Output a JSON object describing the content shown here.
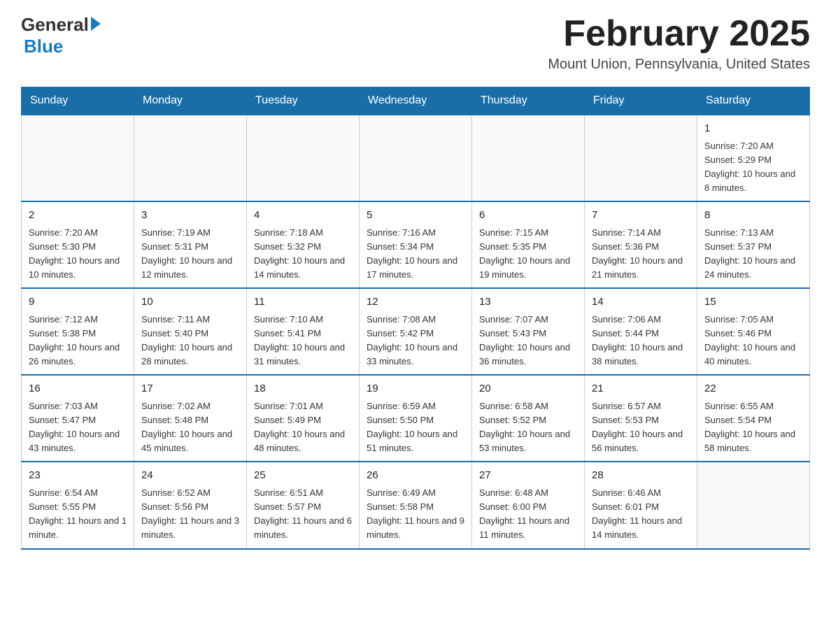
{
  "header": {
    "logo_general": "General",
    "logo_blue": "Blue",
    "month_title": "February 2025",
    "location": "Mount Union, Pennsylvania, United States"
  },
  "weekdays": [
    "Sunday",
    "Monday",
    "Tuesday",
    "Wednesday",
    "Thursday",
    "Friday",
    "Saturday"
  ],
  "weeks": [
    [
      {
        "day": "",
        "info": ""
      },
      {
        "day": "",
        "info": ""
      },
      {
        "day": "",
        "info": ""
      },
      {
        "day": "",
        "info": ""
      },
      {
        "day": "",
        "info": ""
      },
      {
        "day": "",
        "info": ""
      },
      {
        "day": "1",
        "info": "Sunrise: 7:20 AM\nSunset: 5:29 PM\nDaylight: 10 hours and 8 minutes."
      }
    ],
    [
      {
        "day": "2",
        "info": "Sunrise: 7:20 AM\nSunset: 5:30 PM\nDaylight: 10 hours and 10 minutes."
      },
      {
        "day": "3",
        "info": "Sunrise: 7:19 AM\nSunset: 5:31 PM\nDaylight: 10 hours and 12 minutes."
      },
      {
        "day": "4",
        "info": "Sunrise: 7:18 AM\nSunset: 5:32 PM\nDaylight: 10 hours and 14 minutes."
      },
      {
        "day": "5",
        "info": "Sunrise: 7:16 AM\nSunset: 5:34 PM\nDaylight: 10 hours and 17 minutes."
      },
      {
        "day": "6",
        "info": "Sunrise: 7:15 AM\nSunset: 5:35 PM\nDaylight: 10 hours and 19 minutes."
      },
      {
        "day": "7",
        "info": "Sunrise: 7:14 AM\nSunset: 5:36 PM\nDaylight: 10 hours and 21 minutes."
      },
      {
        "day": "8",
        "info": "Sunrise: 7:13 AM\nSunset: 5:37 PM\nDaylight: 10 hours and 24 minutes."
      }
    ],
    [
      {
        "day": "9",
        "info": "Sunrise: 7:12 AM\nSunset: 5:38 PM\nDaylight: 10 hours and 26 minutes."
      },
      {
        "day": "10",
        "info": "Sunrise: 7:11 AM\nSunset: 5:40 PM\nDaylight: 10 hours and 28 minutes."
      },
      {
        "day": "11",
        "info": "Sunrise: 7:10 AM\nSunset: 5:41 PM\nDaylight: 10 hours and 31 minutes."
      },
      {
        "day": "12",
        "info": "Sunrise: 7:08 AM\nSunset: 5:42 PM\nDaylight: 10 hours and 33 minutes."
      },
      {
        "day": "13",
        "info": "Sunrise: 7:07 AM\nSunset: 5:43 PM\nDaylight: 10 hours and 36 minutes."
      },
      {
        "day": "14",
        "info": "Sunrise: 7:06 AM\nSunset: 5:44 PM\nDaylight: 10 hours and 38 minutes."
      },
      {
        "day": "15",
        "info": "Sunrise: 7:05 AM\nSunset: 5:46 PM\nDaylight: 10 hours and 40 minutes."
      }
    ],
    [
      {
        "day": "16",
        "info": "Sunrise: 7:03 AM\nSunset: 5:47 PM\nDaylight: 10 hours and 43 minutes."
      },
      {
        "day": "17",
        "info": "Sunrise: 7:02 AM\nSunset: 5:48 PM\nDaylight: 10 hours and 45 minutes."
      },
      {
        "day": "18",
        "info": "Sunrise: 7:01 AM\nSunset: 5:49 PM\nDaylight: 10 hours and 48 minutes."
      },
      {
        "day": "19",
        "info": "Sunrise: 6:59 AM\nSunset: 5:50 PM\nDaylight: 10 hours and 51 minutes."
      },
      {
        "day": "20",
        "info": "Sunrise: 6:58 AM\nSunset: 5:52 PM\nDaylight: 10 hours and 53 minutes."
      },
      {
        "day": "21",
        "info": "Sunrise: 6:57 AM\nSunset: 5:53 PM\nDaylight: 10 hours and 56 minutes."
      },
      {
        "day": "22",
        "info": "Sunrise: 6:55 AM\nSunset: 5:54 PM\nDaylight: 10 hours and 58 minutes."
      }
    ],
    [
      {
        "day": "23",
        "info": "Sunrise: 6:54 AM\nSunset: 5:55 PM\nDaylight: 11 hours and 1 minute."
      },
      {
        "day": "24",
        "info": "Sunrise: 6:52 AM\nSunset: 5:56 PM\nDaylight: 11 hours and 3 minutes."
      },
      {
        "day": "25",
        "info": "Sunrise: 6:51 AM\nSunset: 5:57 PM\nDaylight: 11 hours and 6 minutes."
      },
      {
        "day": "26",
        "info": "Sunrise: 6:49 AM\nSunset: 5:58 PM\nDaylight: 11 hours and 9 minutes."
      },
      {
        "day": "27",
        "info": "Sunrise: 6:48 AM\nSunset: 6:00 PM\nDaylight: 11 hours and 11 minutes."
      },
      {
        "day": "28",
        "info": "Sunrise: 6:46 AM\nSunset: 6:01 PM\nDaylight: 11 hours and 14 minutes."
      },
      {
        "day": "",
        "info": ""
      }
    ]
  ]
}
